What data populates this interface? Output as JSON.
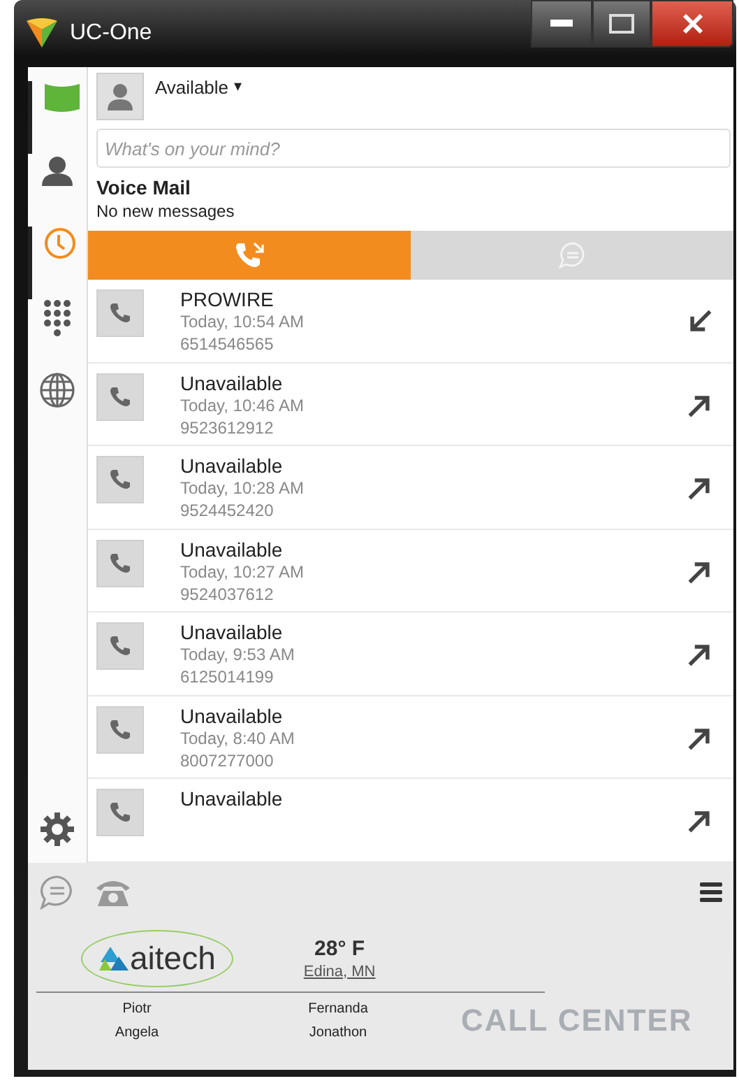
{
  "window": {
    "title": "UC-One"
  },
  "sidebar": {
    "items": [
      {
        "kind": "flag",
        "selected": true
      },
      {
        "kind": "contacts",
        "selected": false
      },
      {
        "kind": "history",
        "selected": true
      },
      {
        "kind": "dialpad",
        "selected": false
      },
      {
        "kind": "web",
        "selected": false
      }
    ]
  },
  "presence": {
    "status": "Available",
    "caret": "▾"
  },
  "mood": {
    "placeholder": "What's on your mind?"
  },
  "voicemail": {
    "title": "Voice Mail",
    "message": "No new messages"
  },
  "tabs": [
    {
      "kind": "calls",
      "selected": true
    },
    {
      "kind": "chat",
      "selected": false
    }
  ],
  "calls": [
    {
      "name": "PROWIRE",
      "time": "Today, 10:54 AM",
      "number": "6514546565",
      "incoming": true
    },
    {
      "name": "Unavailable",
      "time": "Today, 10:46 AM",
      "number": "9523612912",
      "incoming": false
    },
    {
      "name": "Unavailable",
      "time": "Today, 10:28 AM",
      "number": "9524452420",
      "incoming": false
    },
    {
      "name": "Unavailable",
      "time": "Today, 10:27 AM",
      "number": "9524037612",
      "incoming": false
    },
    {
      "name": "Unavailable",
      "time": "Today, 9:53 AM",
      "number": "6125014199",
      "incoming": false
    },
    {
      "name": "Unavailable",
      "time": "Today, 8:40 AM",
      "number": "8007277000",
      "incoming": false
    },
    {
      "name": "Unavailable",
      "incoming": false
    }
  ],
  "footer": {
    "logo": "aitech",
    "temperature": "28° F",
    "location": "Edina, MN",
    "banner": "CALL CENTER",
    "agents": [
      "Piotr",
      "Fernanda",
      "Angela",
      "Jonathon"
    ]
  }
}
